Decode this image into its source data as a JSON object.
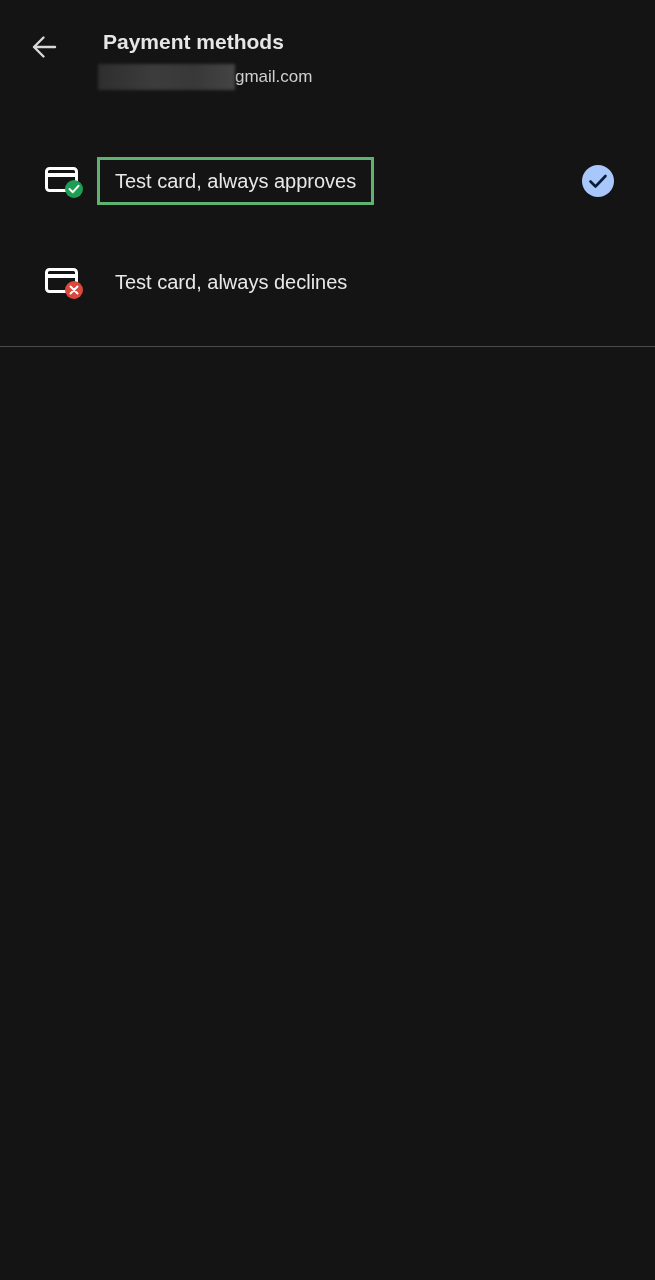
{
  "header": {
    "title": "Payment methods",
    "account": {
      "email": "gmail.com",
      "redacted": true
    }
  },
  "methods": [
    {
      "label": "Test card, always approves",
      "kind": "approves",
      "selected": true,
      "highlighted": true
    },
    {
      "label": "Test card, always declines",
      "kind": "declines",
      "selected": false,
      "highlighted": false
    }
  ]
}
